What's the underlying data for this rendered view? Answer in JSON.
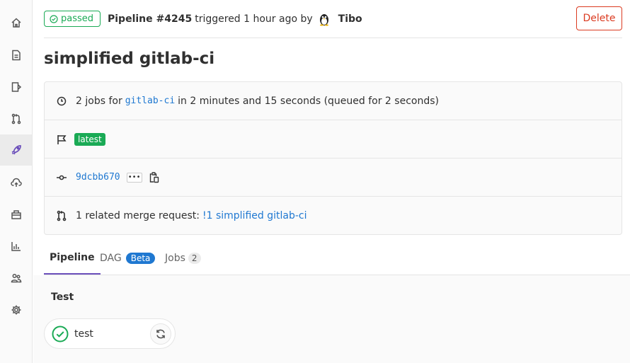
{
  "header": {
    "status_label": "passed",
    "pipeline_label": "Pipeline #4245",
    "triggered_text": "triggered 1 hour ago by",
    "user_name": "Tibo",
    "delete_label": "Delete"
  },
  "page_title": "simplified gitlab-ci",
  "info": {
    "jobs_prefix": "2 jobs for",
    "branch": "gitlab-ci",
    "jobs_suffix": "in 2 minutes and 15 seconds (queued for 2 seconds)",
    "tag": "latest",
    "commit_sha": "9dcbb670",
    "ellipsis": "•••",
    "mr_prefix": "1 related merge request:",
    "mr_link": "!1 simplified gitlab-ci"
  },
  "tabs": [
    {
      "label": "Pipeline"
    },
    {
      "label": "DAG",
      "badge": "Beta"
    },
    {
      "label": "Jobs",
      "badge": "2"
    }
  ],
  "graph": {
    "stage": "Test",
    "job_name": "test"
  },
  "colors": {
    "success": "#1aaa55",
    "danger": "#db3b21",
    "link": "#1f78d1",
    "tab_active": "#6b4fbb"
  },
  "sidebar_icons": [
    "home-icon",
    "repository-icon",
    "issues-icon",
    "merge-requests-icon",
    "ci-cd-icon",
    "operations-icon",
    "packages-icon",
    "analytics-icon",
    "members-icon",
    "settings-icon"
  ]
}
